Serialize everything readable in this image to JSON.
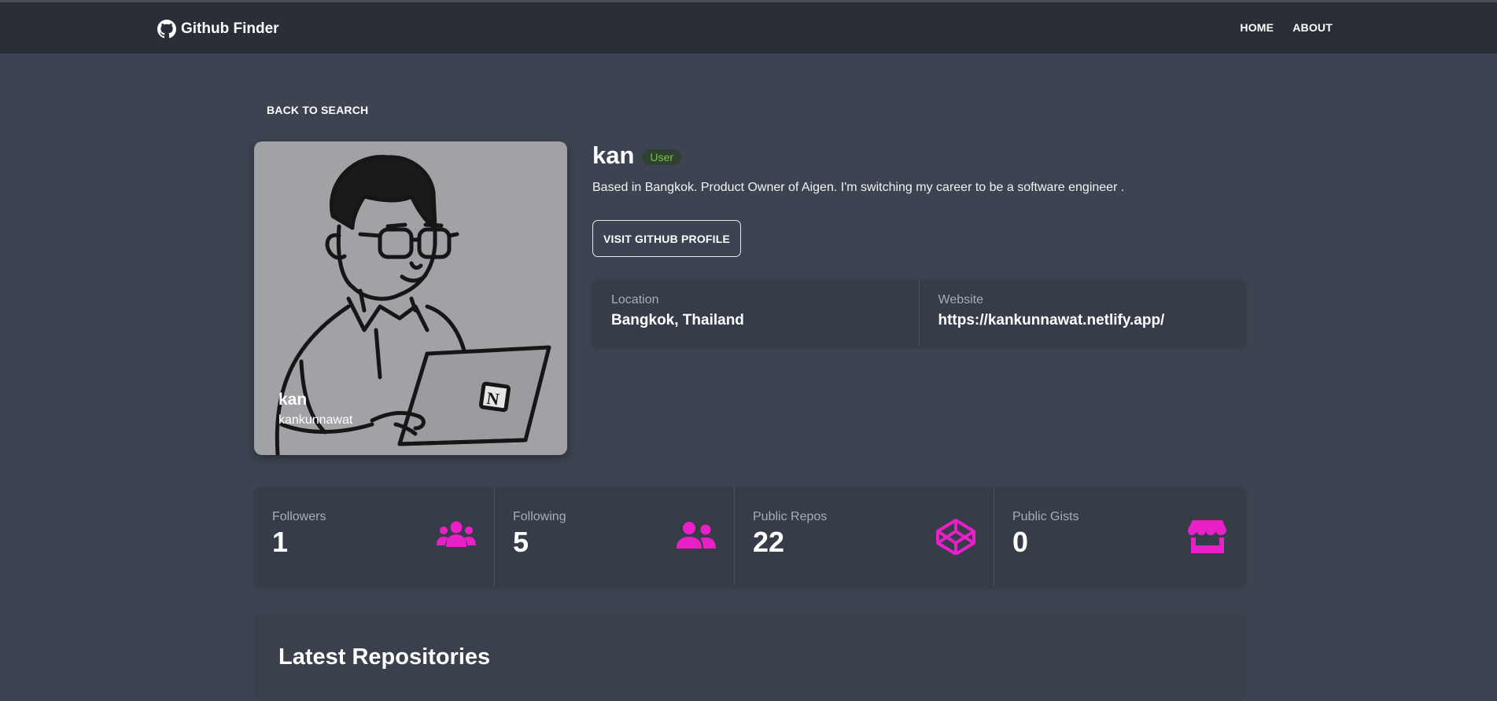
{
  "app": {
    "brand": "Github Finder",
    "nav": [
      "HOME",
      "ABOUT"
    ]
  },
  "back_label": "BACK TO SEARCH",
  "profile": {
    "name": "kan",
    "login": "kankunnawat",
    "type_badge": "User",
    "bio": "Based in Bangkok. Product Owner of Aigen. I'm switching my career to be a software engineer .",
    "visit_label": "VISIT GITHUB PROFILE",
    "location_label": "Location",
    "location": "Bangkok, Thailand",
    "website_label": "Website",
    "website": "https://kankunnawat.netlify.app/"
  },
  "stats": [
    {
      "label": "Followers",
      "value": "1",
      "icon": "users-icon"
    },
    {
      "label": "Following",
      "value": "5",
      "icon": "user-friends-icon"
    },
    {
      "label": "Public Repos",
      "value": "22",
      "icon": "codepen-icon"
    },
    {
      "label": "Public Gists",
      "value": "0",
      "icon": "store-icon"
    }
  ],
  "colors": {
    "background": "#3d4451",
    "navbar": "#2a2e37",
    "accent_icon": "#e91fc8",
    "badge_text": "#7ac142"
  },
  "repos_heading": "Latest Repositories"
}
